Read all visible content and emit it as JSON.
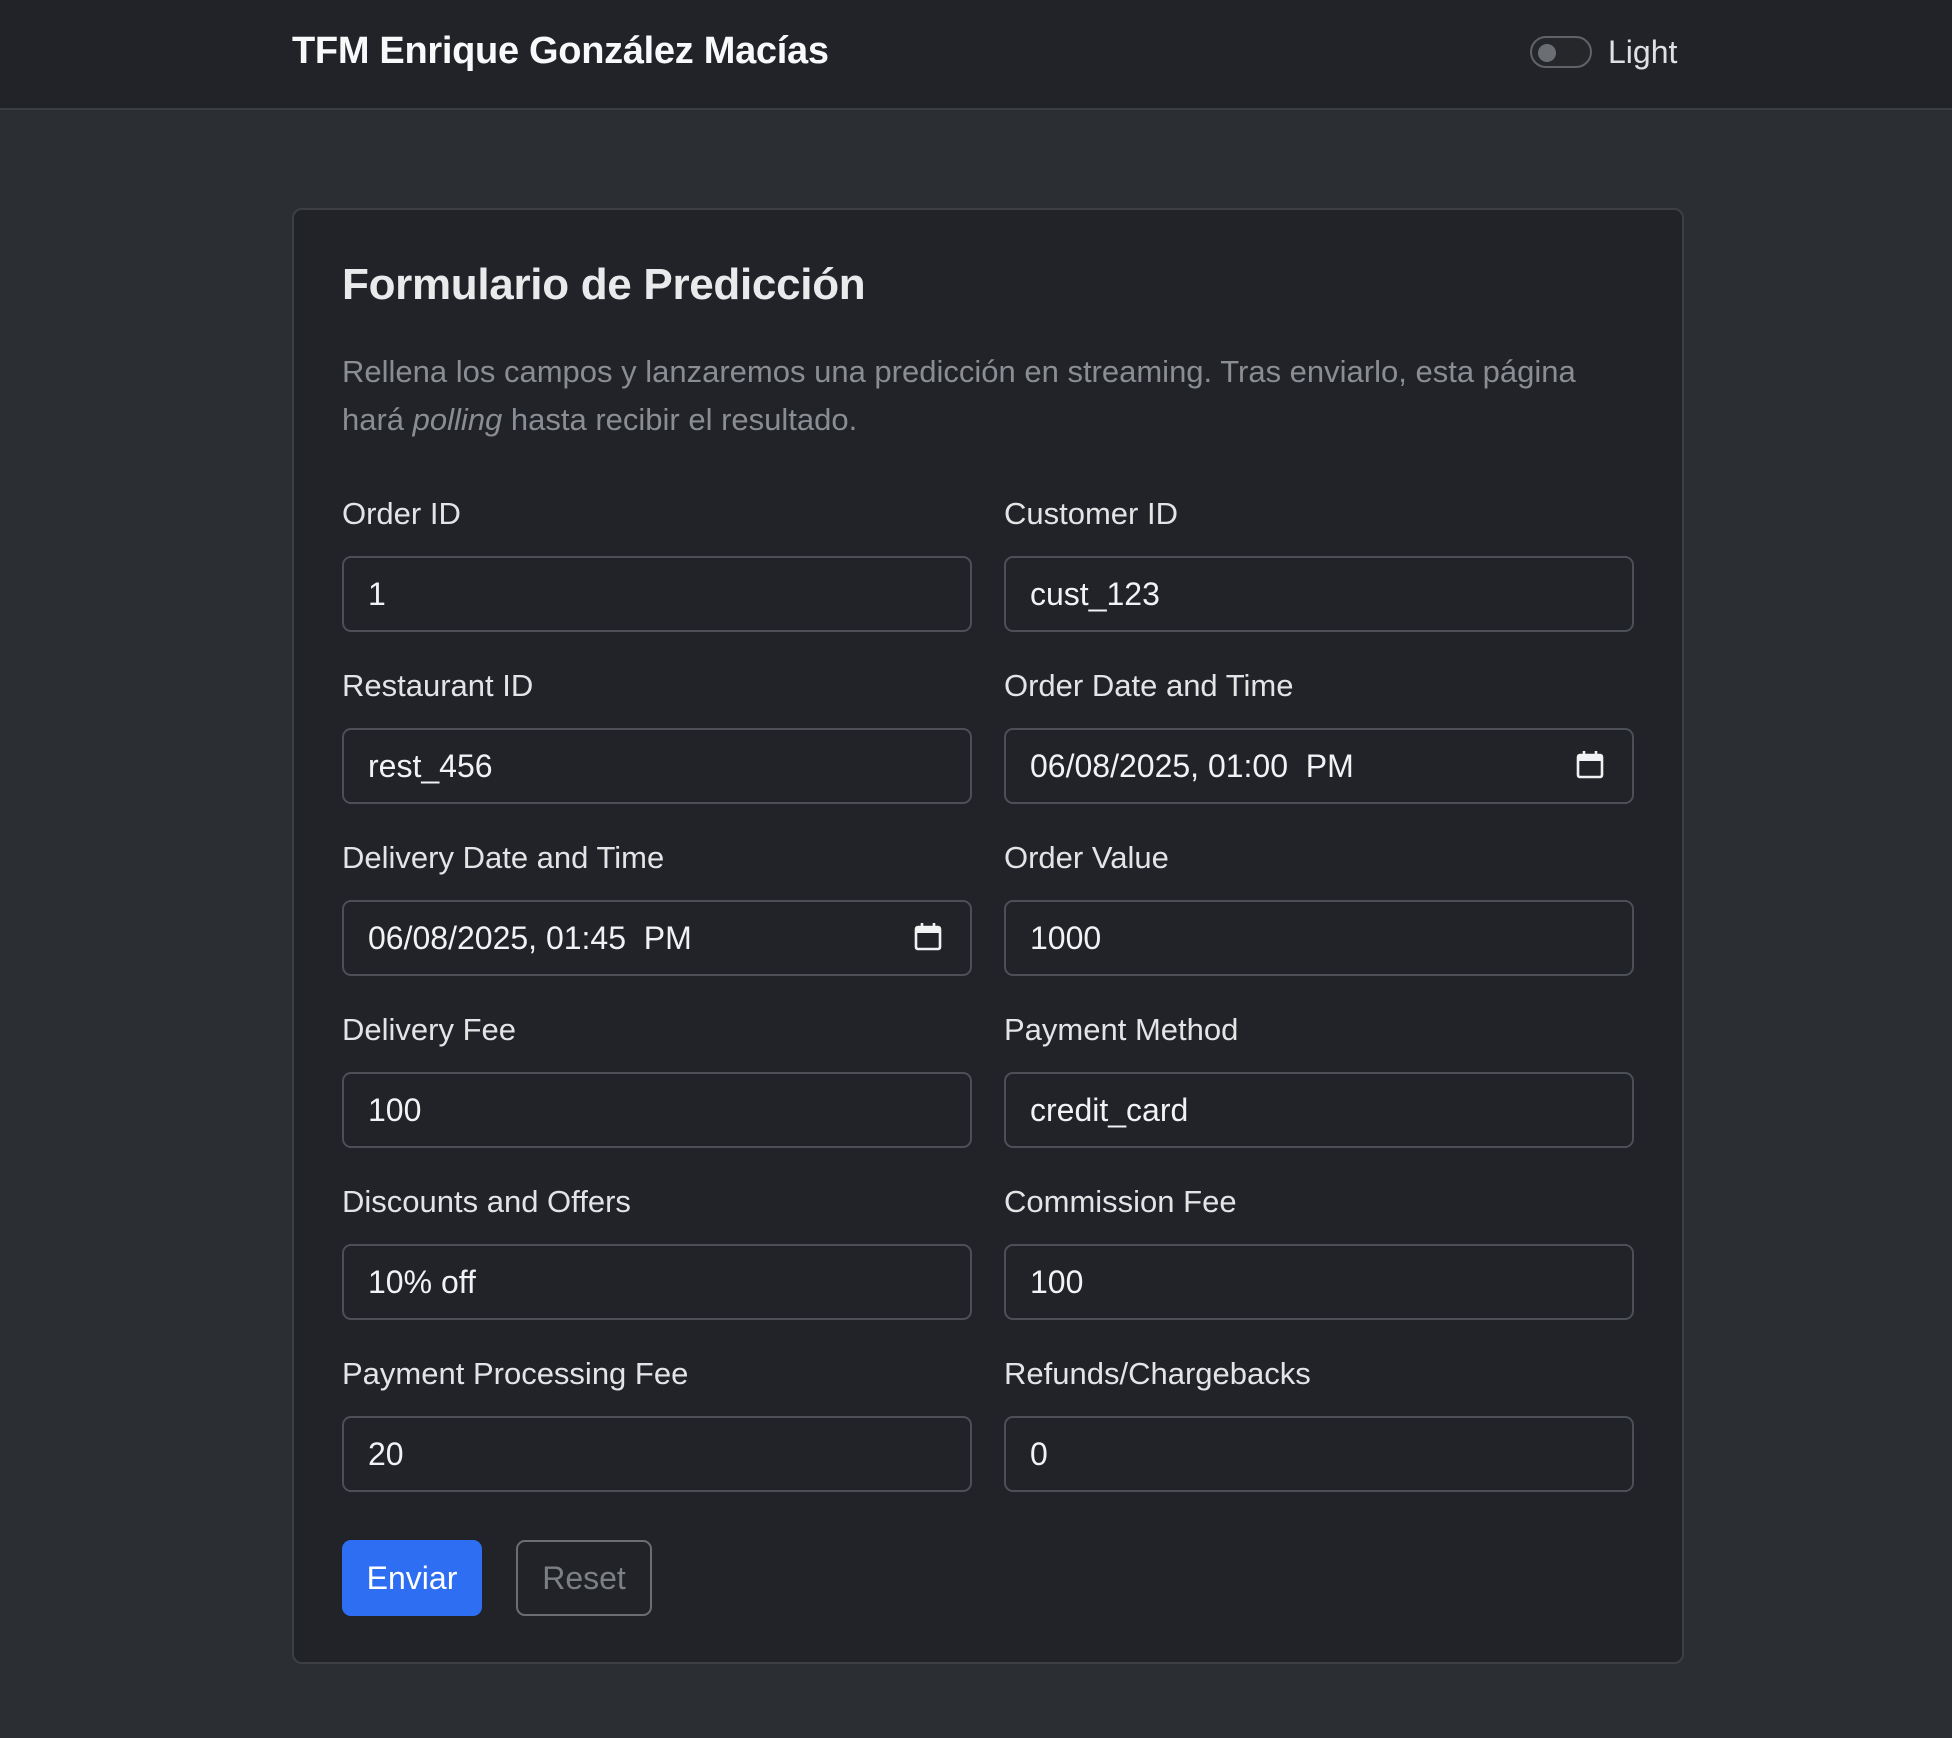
{
  "navbar": {
    "brand": "TFM Enrique González Macías",
    "theme_label": "Light",
    "theme_on": false
  },
  "form": {
    "title": "Formulario de Predicción",
    "intro_before": "Rellena los campos y lanzaremos una predicción en streaming. Tras enviarlo, esta página hará ",
    "intro_em": "polling",
    "intro_after": " hasta recibir el resultado.",
    "fields": {
      "order_id": {
        "label": "Order ID",
        "value": "1"
      },
      "customer_id": {
        "label": "Customer ID",
        "value": "cust_123"
      },
      "restaurant_id": {
        "label": "Restaurant ID",
        "value": "rest_456"
      },
      "order_datetime": {
        "label": "Order Date and Time",
        "value": "06/08/2025, 01:00  PM"
      },
      "delivery_datetime": {
        "label": "Delivery Date and Time",
        "value": "06/08/2025, 01:45  PM"
      },
      "order_value": {
        "label": "Order Value",
        "value": "1000"
      },
      "delivery_fee": {
        "label": "Delivery Fee",
        "value": "100"
      },
      "payment_method": {
        "label": "Payment Method",
        "value": "credit_card"
      },
      "discounts": {
        "label": "Discounts and Offers",
        "value": "10% off"
      },
      "commission_fee": {
        "label": "Commission Fee",
        "value": "100"
      },
      "payment_processing_fee": {
        "label": "Payment Processing Fee",
        "value": "20"
      },
      "refunds": {
        "label": "Refunds/Chargebacks",
        "value": "0"
      }
    },
    "submit_label": "Enviar",
    "reset_label": "Reset"
  },
  "colors": {
    "background": "#2b2e33",
    "card": "#212328",
    "primary": "#2d6ef3",
    "muted_text": "#8a8e93"
  },
  "icons": [
    "calendar-icon"
  ]
}
